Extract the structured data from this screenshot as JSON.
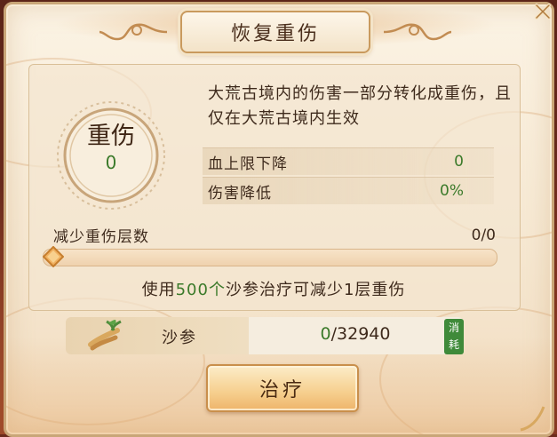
{
  "title": "恢复重伤",
  "injury": {
    "label": "重伤",
    "value": "0"
  },
  "description": "大荒古境内的伤害一部分转化成重伤，且仅在大荒古境内生效",
  "stats": [
    {
      "label": "血上限下降",
      "value": "0"
    },
    {
      "label": "伤害降低",
      "value": "0%"
    }
  ],
  "reduce": {
    "label": "减少重伤层数",
    "value": "0/0",
    "slider_fraction": 0
  },
  "usage": {
    "prefix": "使用",
    "amount": "500个",
    "suffix": "沙参治疗可减少1层重伤"
  },
  "material": {
    "name": "沙参",
    "have": "0",
    "need": "/32940",
    "consume_tag_1": "消",
    "consume_tag_2": "耗",
    "icon": "herb-root-icon"
  },
  "treat_button": "治疗",
  "colors": {
    "green": "#3b7a2a",
    "text": "#3e2a1c",
    "accent": "#c99a5e"
  }
}
